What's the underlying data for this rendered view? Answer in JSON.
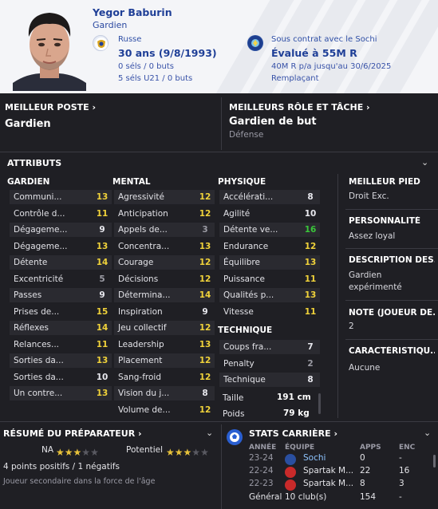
{
  "player": {
    "name": "Yegor Baburin",
    "role": "Gardien",
    "nationality": "Russe",
    "age_line": "30 ans (9/8/1993)",
    "caps": "0 séls / 0 buts",
    "u21_caps": "5 séls U21 / 0 buts",
    "contract": "Sous contrat avec le Sochi",
    "value": "Évalué à 55M R",
    "wage": "40M R p/a jusqu'au 30/6/2025",
    "squad_status": "Remplaçant"
  },
  "best_position": {
    "heading": "MEILLEUR POSTE",
    "value": "Gardien"
  },
  "best_role": {
    "heading": "MEILLEURS RÔLE ET TÂCHE",
    "value": "Gardien de but",
    "duty": "Défense"
  },
  "attributes": {
    "heading": "ATTRIBUTS",
    "goalkeeper": {
      "heading": "GARDIEN",
      "rows": [
        {
          "name": "Communi...",
          "value": "13"
        },
        {
          "name": "Contrôle d...",
          "value": "11"
        },
        {
          "name": "Dégageme...",
          "value": "9"
        },
        {
          "name": "Dégageme...",
          "value": "13"
        },
        {
          "name": "Détente",
          "value": "14"
        },
        {
          "name": "Excentricité",
          "value": "5"
        },
        {
          "name": "Passes",
          "value": "9"
        },
        {
          "name": "Prises de...",
          "value": "15"
        },
        {
          "name": "Réflexes",
          "value": "14"
        },
        {
          "name": "Relances...",
          "value": "11"
        },
        {
          "name": "Sorties da...",
          "value": "13"
        },
        {
          "name": "Sorties da...",
          "value": "10"
        },
        {
          "name": "Un contre...",
          "value": "13"
        }
      ]
    },
    "mental": {
      "heading": "MENTAL",
      "rows": [
        {
          "name": "Agressivité",
          "value": "12"
        },
        {
          "name": "Anticipation",
          "value": "12"
        },
        {
          "name": "Appels de...",
          "value": "3"
        },
        {
          "name": "Concentra...",
          "value": "13"
        },
        {
          "name": "Courage",
          "value": "12"
        },
        {
          "name": "Décisions",
          "value": "12"
        },
        {
          "name": "Détermina...",
          "value": "14"
        },
        {
          "name": "Inspiration",
          "value": "9"
        },
        {
          "name": "Jeu collectif",
          "value": "12"
        },
        {
          "name": "Leadership",
          "value": "13"
        },
        {
          "name": "Placement",
          "value": "12"
        },
        {
          "name": "Sang-froid",
          "value": "12"
        },
        {
          "name": "Vision du j...",
          "value": "8"
        },
        {
          "name": "Volume de...",
          "value": "12"
        }
      ]
    },
    "physical": {
      "heading": "PHYSIQUE",
      "rows": [
        {
          "name": "Accélérati...",
          "value": "8"
        },
        {
          "name": "Agilité",
          "value": "10"
        },
        {
          "name": "Détente ve...",
          "value": "16"
        },
        {
          "name": "Endurance",
          "value": "12"
        },
        {
          "name": "Équilibre",
          "value": "13"
        },
        {
          "name": "Puissance",
          "value": "11"
        },
        {
          "name": "Qualités p...",
          "value": "13"
        },
        {
          "name": "Vitesse",
          "value": "11"
        }
      ]
    },
    "technical": {
      "heading": "TECHNIQUE",
      "rows": [
        {
          "name": "Coups fra...",
          "value": "7"
        },
        {
          "name": "Penalty",
          "value": "2"
        },
        {
          "name": "Technique",
          "value": "8"
        }
      ]
    },
    "height_label": "Taille",
    "height": "191 cm",
    "weight_label": "Poids",
    "weight": "79 kg"
  },
  "side": {
    "foot_h": "MEILLEUR PIED",
    "foot": "Droit Exc.",
    "pers_h": "PERSONNALITÉ",
    "pers": "Assez loyal",
    "desc_h": "DESCRIPTION DES...",
    "desc": "Gardien expérimenté",
    "note_h": "NOTE (JOUEUR DE...",
    "note": "2",
    "traits_h": "CARACTÉRISTIQU...",
    "traits": "Aucune"
  },
  "coach": {
    "heading": "RÉSUMÉ DU PRÉPARATEUR",
    "current_label": "NA",
    "current_stars": 3,
    "potential_label": "Potentiel",
    "potential_stars": 3,
    "summary": "4 points positifs / 1 négatifs",
    "note": "Joueur secondaire dans la force de l'âge"
  },
  "career": {
    "heading": "STATS CARRIÈRE",
    "col_year": "ANNÉE",
    "col_team": "ÉQUIPE",
    "col_apps": "APPS",
    "col_enc": "ENC",
    "rows": [
      {
        "year": "23-24",
        "team": "Sochi",
        "apps": "0",
        "enc": "-"
      },
      {
        "year": "22-24",
        "team": "Spartak M...",
        "apps": "22",
        "enc": "16"
      },
      {
        "year": "22-23",
        "team": "Spartak M...",
        "apps": "8",
        "enc": "3"
      }
    ],
    "total_label": "Général",
    "total_clubs": "10 club(s)",
    "total_apps": "154",
    "total_enc": "-"
  },
  "colors": {
    "accent": "#1f3f97",
    "high": "#f0d23a",
    "good": "#3ac63a"
  }
}
